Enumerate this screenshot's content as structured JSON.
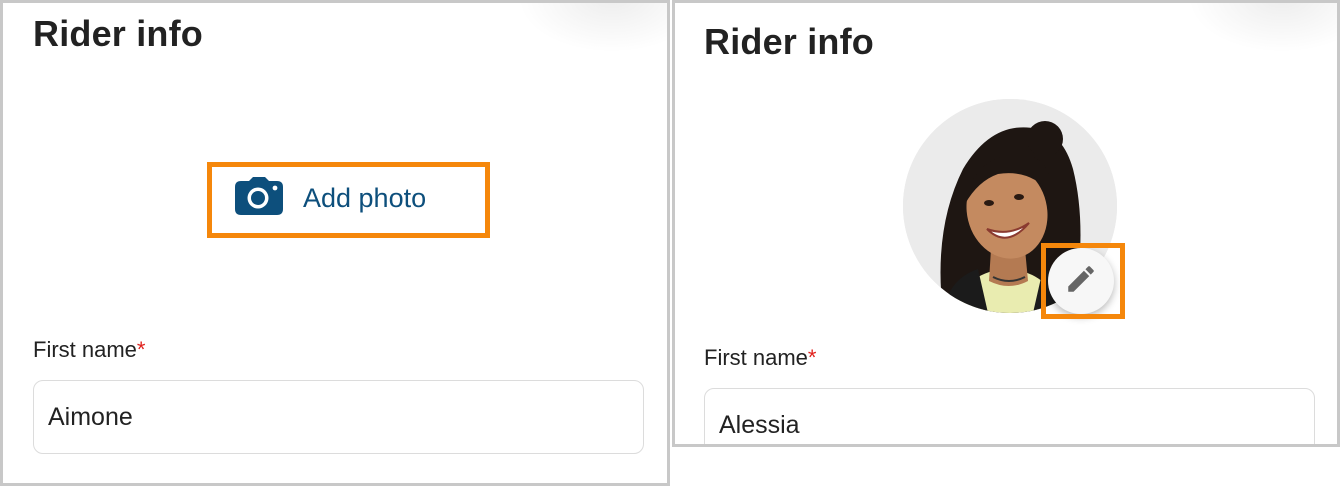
{
  "left_panel": {
    "title": "Rider info",
    "add_photo_label": "Add photo",
    "first_name_label": "First name",
    "required_marker": "*",
    "first_name_value": "Aimone"
  },
  "right_panel": {
    "title": "Rider info",
    "first_name_label": "First name",
    "required_marker": "*",
    "first_name_value": "Alessia"
  },
  "colors": {
    "highlight": "#f5870b",
    "accent": "#0d4f7c",
    "required": "#e0201b"
  },
  "icons": {
    "add_photo": "camera-icon",
    "edit_photo": "pencil-icon"
  }
}
